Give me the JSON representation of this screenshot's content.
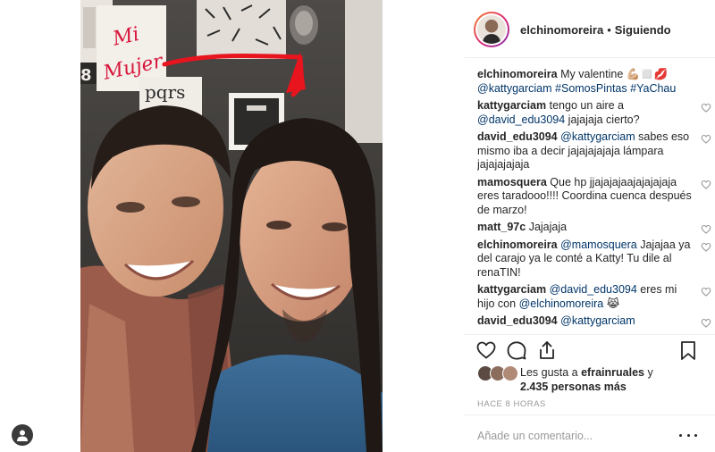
{
  "post": {
    "author": "elchinomoreira",
    "dot": "•",
    "follow_status": "Siguiendo",
    "photo": {
      "sign_text_line1": "Mi",
      "sign_text_line2": "Mujer"
    }
  },
  "comments": [
    {
      "user": "elchinomoreira",
      "parts": [
        {
          "t": "My valentine 💪🏼◻️💋 ",
          "m": false
        },
        {
          "t": "@kattygarciam",
          "m": true
        },
        {
          "t": " ",
          "m": false
        },
        {
          "t": "#SomosPintas",
          "m": true
        },
        {
          "t": " ",
          "m": false
        },
        {
          "t": "#YaChau",
          "m": true
        }
      ],
      "heart": false
    },
    {
      "user": "kattygarciam",
      "parts": [
        {
          "t": "tengo un aire a ",
          "m": false
        },
        {
          "t": "@david_edu3094",
          "m": true
        },
        {
          "t": " jajajaja cierto?",
          "m": false
        }
      ],
      "heart": true
    },
    {
      "user": "david_edu3094",
      "parts": [
        {
          "t": "@kattygarciam",
          "m": true
        },
        {
          "t": " sabes eso mismo iba a decir jajajajajaja lámpara jajajajajaja",
          "m": false
        }
      ],
      "heart": true
    },
    {
      "user": "mamosquera",
      "parts": [
        {
          "t": "Que hp jjajajajaajajajajaja eres taradooo!!!! Coordina cuenca después de marzo!",
          "m": false
        }
      ],
      "heart": true
    },
    {
      "user": "matt_97c",
      "parts": [
        {
          "t": "Jajajaja",
          "m": false
        }
      ],
      "heart": true
    },
    {
      "user": "elchinomoreira",
      "parts": [
        {
          "t": "@mamosquera",
          "m": true
        },
        {
          "t": " Jajajaa ya del carajo ya le conté a Katty! Tu dile al renaTIN!",
          "m": false
        }
      ],
      "heart": true
    },
    {
      "user": "kattygarciam",
      "parts": [
        {
          "t": "@david_edu3094",
          "m": true
        },
        {
          "t": " eres mi hijo con ",
          "m": false
        },
        {
          "t": "@elchinomoreira",
          "m": true
        },
        {
          "t": " 😹",
          "m": false
        }
      ],
      "heart": true
    },
    {
      "user": "david_edu3094",
      "parts": [
        {
          "t": "@kattygarciam",
          "m": true
        }
      ],
      "heart": true
    }
  ],
  "likes": {
    "prefix": "Les gusta a ",
    "first_liker": "efrainruales",
    "joiner": " y",
    "others": "2.435 personas más"
  },
  "time_ago": "HACE 8 HORAS",
  "add_comment_placeholder": "Añade un comentario...",
  "icons": {
    "like": "heart-icon",
    "comment": "comment-bubble-icon",
    "share": "share-icon",
    "save": "bookmark-icon",
    "more": "more-options-icon",
    "profile": "user-profile-icon"
  },
  "colors": {
    "text": "#262626",
    "mention": "#003569",
    "muted": "#999999",
    "separator": "#efefef",
    "story_ring_start": "#f58529",
    "story_ring_end": "#8134af",
    "arrow_red": "#e8141e",
    "sign_red": "#d8183d"
  }
}
